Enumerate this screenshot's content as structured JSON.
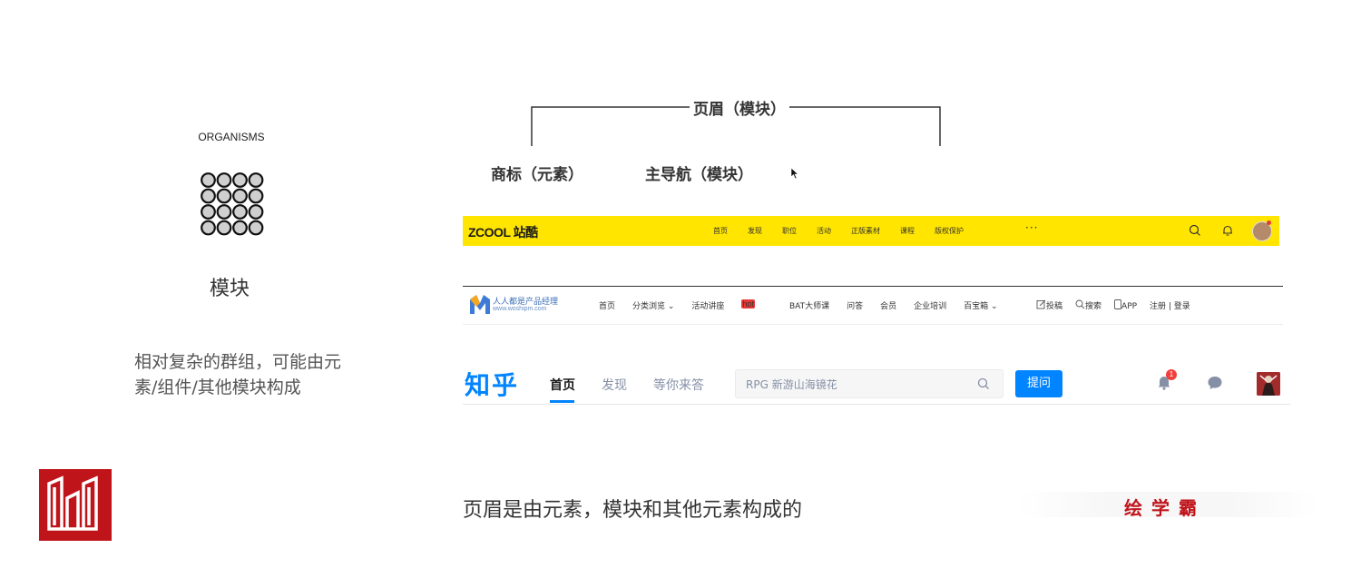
{
  "left": {
    "organisms_label": "ORGANISMS",
    "module_title": "模块",
    "description_line1": "相对复杂的群组，可能由元",
    "description_line2": "素/组件/其他模块构成",
    "circle_icon": "molecule-grid-icon",
    "brand_logo_icon": "brand-logo-icon",
    "brand_color": "#c0141b"
  },
  "diagram": {
    "header_label": "页眉（模块）",
    "logo_label": "商标（元素）",
    "nav_label": "主导航（模块）"
  },
  "zcool": {
    "logo": "ZCOOL 站酷",
    "nav": [
      "首页",
      "发现",
      "职位",
      "活动",
      "正版素材",
      "课程",
      "版权保护"
    ],
    "more": "···",
    "bg_color": "#ffe500"
  },
  "woshipm": {
    "name": "人人都是产品经理",
    "url": "www.woshipm.com",
    "nav": [
      "首页",
      "分类浏览 ⌄",
      "活动讲座",
      "BAT大师课",
      "问答",
      "会员",
      "企业培训",
      "百宝箱 ⌄"
    ],
    "hot_badge": "hot",
    "right": {
      "post": "投稿",
      "search": "搜索",
      "app": "APP",
      "auth": "注册 | 登录"
    }
  },
  "zhihu": {
    "logo": "知乎",
    "tabs": [
      "首页",
      "发现",
      "等你来答"
    ],
    "search_placeholder": "RPG 新游山海镜花",
    "ask_button": "提问",
    "notification_count": "1",
    "accent_color": "#0084ff"
  },
  "footer": {
    "caption": "页眉是由元素，模块和其他元素构成的",
    "watermark": "绘学霸"
  }
}
